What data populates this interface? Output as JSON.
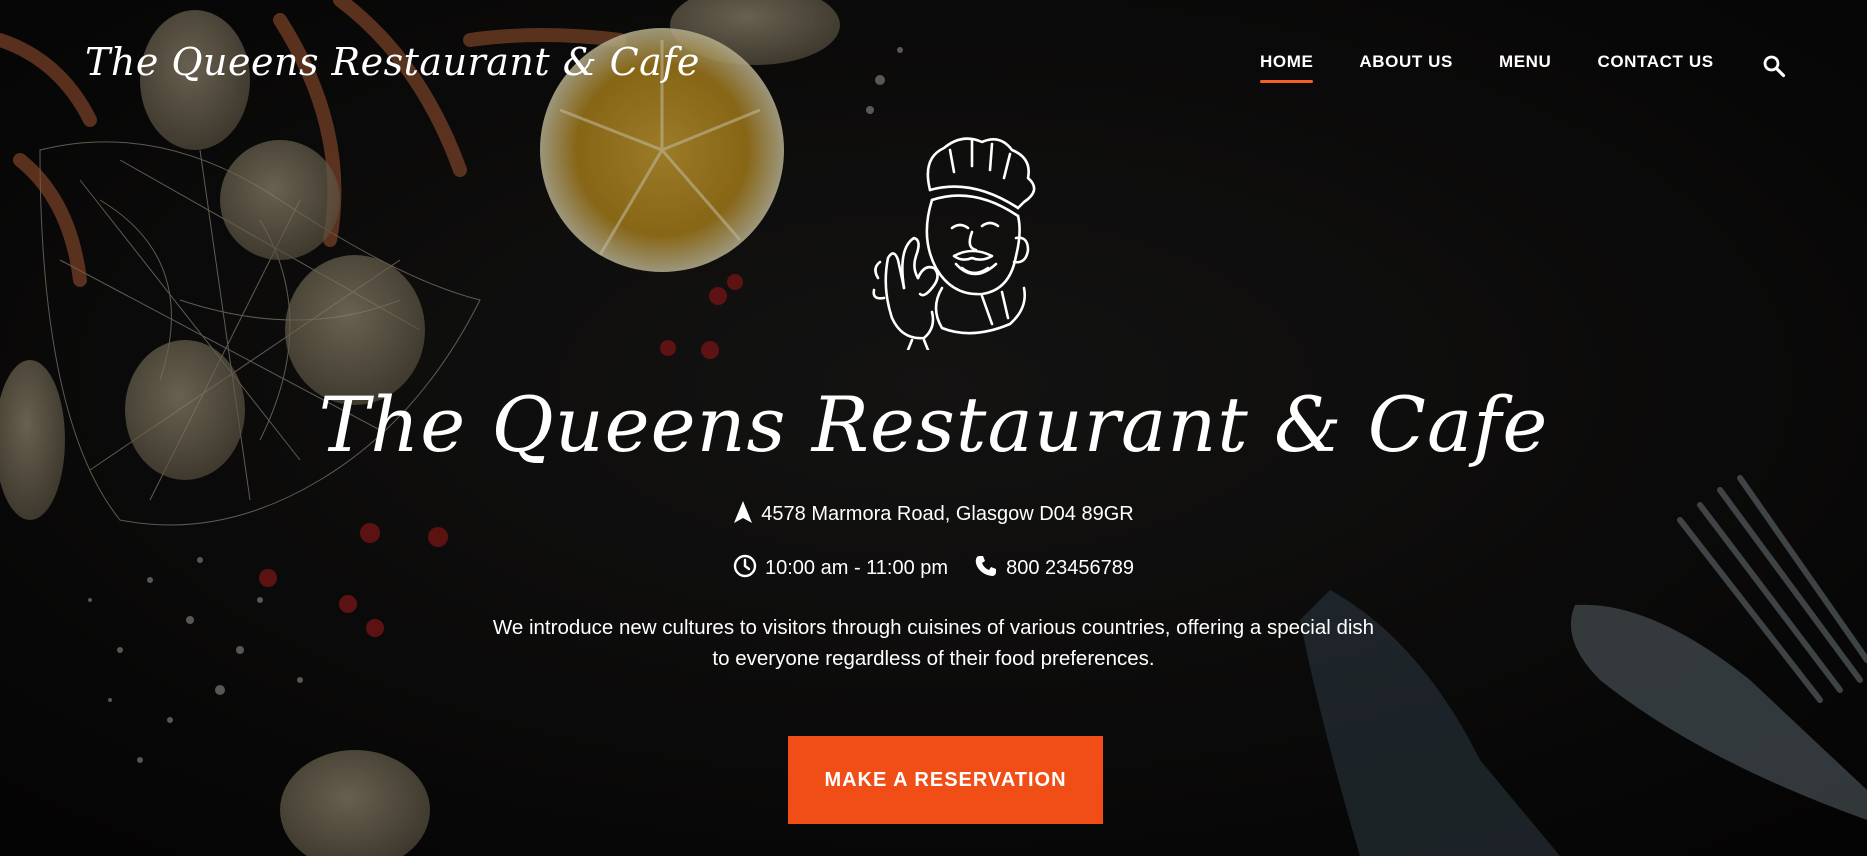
{
  "header": {
    "brand": "The Queens Restaurant & Cafe"
  },
  "nav": {
    "items": [
      {
        "label": "HOME",
        "active": true
      },
      {
        "label": "ABOUT US",
        "active": false
      },
      {
        "label": "MENU",
        "active": false
      },
      {
        "label": "CONTACT US",
        "active": false
      }
    ],
    "search_icon": "search-icon"
  },
  "hero": {
    "logo_icon": "chef-illustration",
    "title": "The Queens Restaurant & Cafe",
    "address": "4578 Marmora Road, Glasgow D04 89GR",
    "hours": "10:00 am - 11:00 pm",
    "phone": "800 23456789",
    "description_line1": "We introduce new cultures to visitors through cuisines of various countries, offering a special dish",
    "description_line2": "to everyone regardless of their food preferences.",
    "cta_label": "MAKE A RESERVATION"
  },
  "colors": {
    "accent": "#f04e16",
    "nav_underline": "#f26122",
    "background": "#0b0a0a"
  }
}
